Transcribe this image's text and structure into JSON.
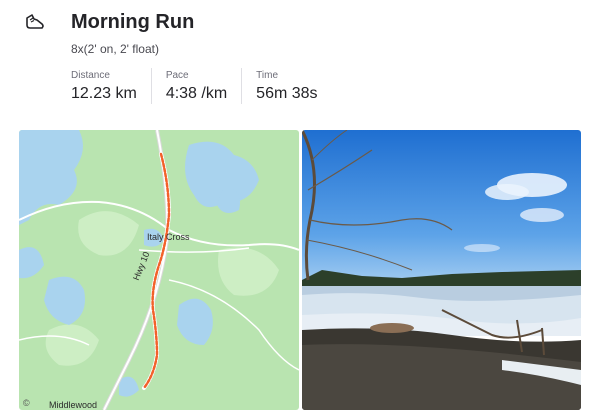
{
  "activity": {
    "icon": "shoe-icon",
    "title": "Morning Run",
    "description": "8x(2' on, 2' float)"
  },
  "stats": [
    {
      "label": "Distance",
      "value": "12.23 km"
    },
    {
      "label": "Pace",
      "value": "4:38 /km"
    },
    {
      "label": "Time",
      "value": "56m 38s"
    }
  ],
  "map": {
    "labels": {
      "place_center": "Italy Cross",
      "road": "Hwy 10",
      "place_bottom": "Middlewood",
      "copyright": "©"
    },
    "colors": {
      "land": "#b9e4b0",
      "water": "#a9d3ee",
      "route": "#f2612a"
    }
  },
  "photo": {
    "alt": "Lake shore in winter"
  }
}
